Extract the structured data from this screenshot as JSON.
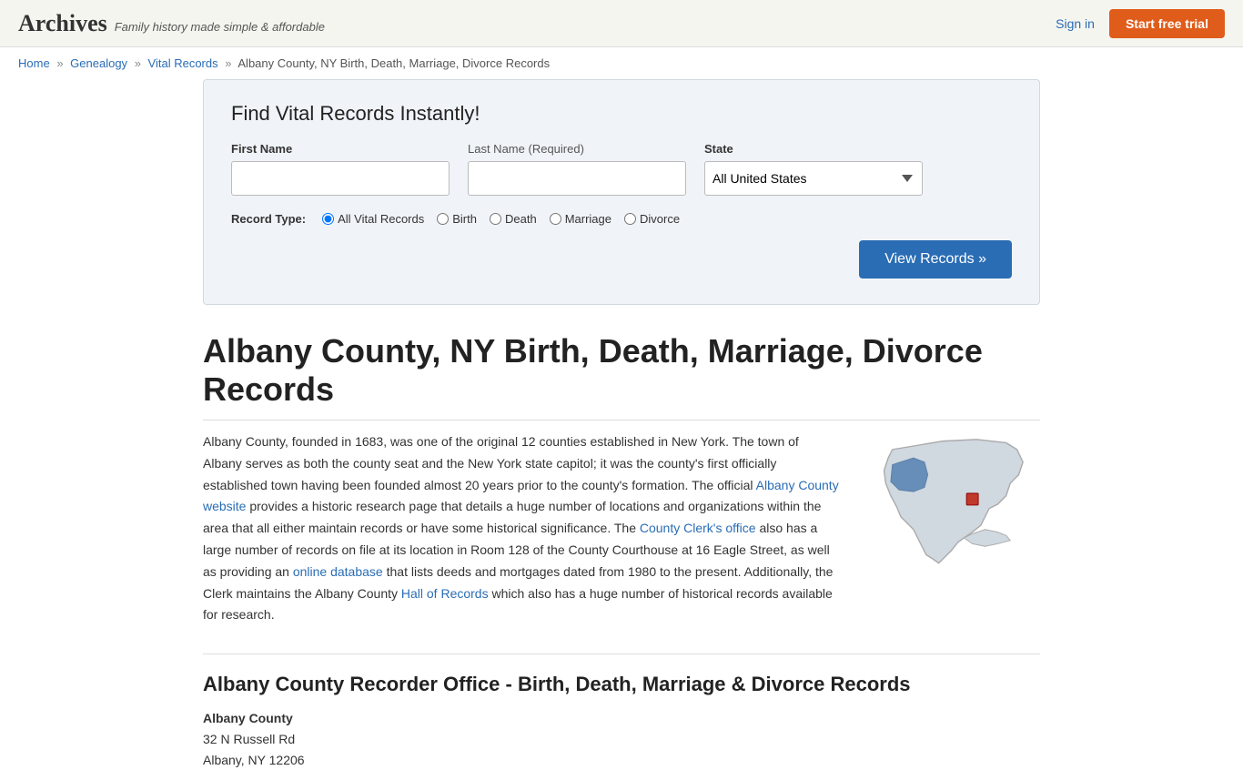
{
  "header": {
    "logo": "Archives",
    "tagline": "Family history made simple & affordable",
    "sign_in_label": "Sign in",
    "start_trial_label": "Start free trial"
  },
  "breadcrumb": {
    "home": "Home",
    "genealogy": "Genealogy",
    "vital_records": "Vital Records",
    "current": "Albany County, NY Birth, Death, Marriage, Divorce Records"
  },
  "search": {
    "title": "Find Vital Records Instantly!",
    "first_name_label": "First Name",
    "last_name_label": "Last Name",
    "last_name_required": "(Required)",
    "state_label": "State",
    "state_default": "All United States",
    "record_type_label": "Record Type:",
    "record_types": [
      "All Vital Records",
      "Birth",
      "Death",
      "Marriage",
      "Divorce"
    ],
    "view_records_label": "View Records »",
    "first_name_placeholder": "",
    "last_name_placeholder": ""
  },
  "page": {
    "title": "Albany County, NY Birth, Death, Marriage, Divorce Records",
    "description_p1": "Albany County, founded in 1683, was one of the original 12 counties established in New York. The town of Albany serves as both the county seat and the New York state capitol; it was the county's first officially established town having been founded almost 20 years prior to the county's formation. The official ",
    "albany_county_link": "Albany County website",
    "description_p2": " provides a historic research page that details a huge number of locations and organizations within the area that all either maintain records or have some historical significance. The ",
    "county_clerk_link": "County Clerk's office",
    "description_p3": " also has a large number of records on file at its location in Room 128 of the County Courthouse at 16 Eagle Street, as well as providing an ",
    "online_db_link": "online database",
    "description_p4": " that lists deeds and mortgages dated from 1980 to the present. Additionally, the Clerk maintains the Albany County ",
    "hall_of_records_link": "Hall of Records",
    "description_p5": " which also has a huge number of historical records available for research.",
    "recorder_title": "Albany County Recorder Office - Birth, Death, Marriage & Divorce Records",
    "office_name": "Albany County",
    "address_line1": "32 N Russell Rd",
    "address_line2": "Albany, NY 12206"
  }
}
